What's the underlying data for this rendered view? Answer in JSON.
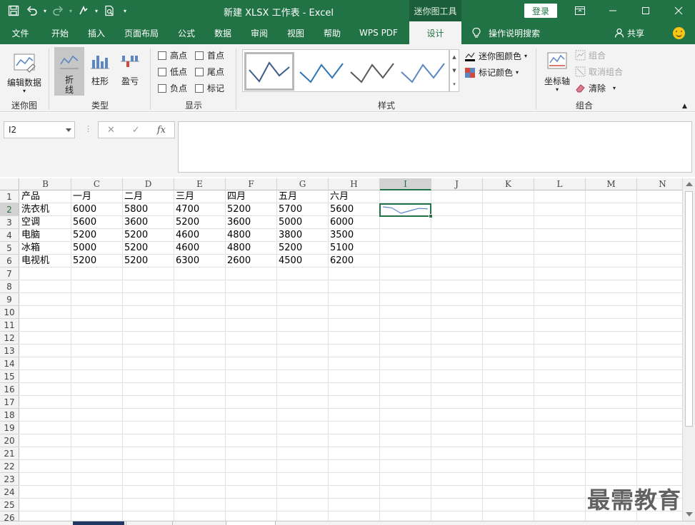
{
  "titlebar": {
    "title": "新建 XLSX 工作表  -  Excel",
    "context_tool": "迷你图工具",
    "login": "登录"
  },
  "tabs": [
    {
      "label": "文件"
    },
    {
      "label": "开始"
    },
    {
      "label": "插入"
    },
    {
      "label": "页面布局"
    },
    {
      "label": "公式"
    },
    {
      "label": "数据"
    },
    {
      "label": "审阅"
    },
    {
      "label": "视图"
    },
    {
      "label": "帮助"
    },
    {
      "label": "WPS PDF"
    },
    {
      "label": "设计"
    }
  ],
  "tell_me": "操作说明搜索",
  "share": "共享",
  "ribbon": {
    "sparkline_group": {
      "edit_data": "编辑数据",
      "label": "迷你图"
    },
    "type_group": {
      "line_1": "折",
      "line_2": "线",
      "column": "柱形",
      "winloss": "盈亏",
      "label": "类型"
    },
    "show_group": {
      "high": "高点",
      "low": "低点",
      "negative": "负点",
      "first": "首点",
      "last": "尾点",
      "markers": "标记",
      "label": "显示"
    },
    "style_group": {
      "label": "样式",
      "sparkline_color": "迷你图颜色",
      "marker_color": "标记颜色"
    },
    "group_group": {
      "axis": "坐标轴",
      "group": "组合",
      "ungroup": "取消组合",
      "clear": "清除",
      "label": "组合"
    }
  },
  "formula_bar": {
    "name_box": "I2",
    "formula": "",
    "fx": "fx"
  },
  "columns": [
    "B",
    "C",
    "D",
    "E",
    "F",
    "G",
    "H",
    "I",
    "J",
    "K",
    "L",
    "M",
    "N"
  ],
  "rows": [
    "1",
    "2",
    "3",
    "4",
    "5",
    "6",
    "7",
    "8",
    "9",
    "10",
    "11",
    "12",
    "13",
    "14",
    "15",
    "16",
    "17",
    "18",
    "19",
    "20",
    "21",
    "22",
    "23",
    "24",
    "25",
    "26"
  ],
  "table": {
    "header": [
      "产品",
      "一月",
      "二月",
      "三月",
      "四月",
      "五月",
      "六月"
    ],
    "data": [
      [
        "洗衣机",
        "6000",
        "5800",
        "4700",
        "5200",
        "5700",
        "5600"
      ],
      [
        "空调",
        "5600",
        "3600",
        "5200",
        "3600",
        "5000",
        "6000"
      ],
      [
        "电脑",
        "5200",
        "5200",
        "4600",
        "4800",
        "3800",
        "3500"
      ],
      [
        "冰箱",
        "5000",
        "5200",
        "4600",
        "4800",
        "5200",
        "5100"
      ],
      [
        "电视机",
        "5200",
        "5200",
        "6300",
        "2600",
        "4500",
        "6200"
      ]
    ]
  },
  "sparkline": {
    "values": [
      6000,
      5800,
      4700,
      5200,
      5700,
      5600
    ],
    "color": "#5b87c5"
  },
  "colors": {
    "brand": "#217346",
    "ribbon_bg": "#f3f3f3"
  },
  "watermark": "最需教育"
}
